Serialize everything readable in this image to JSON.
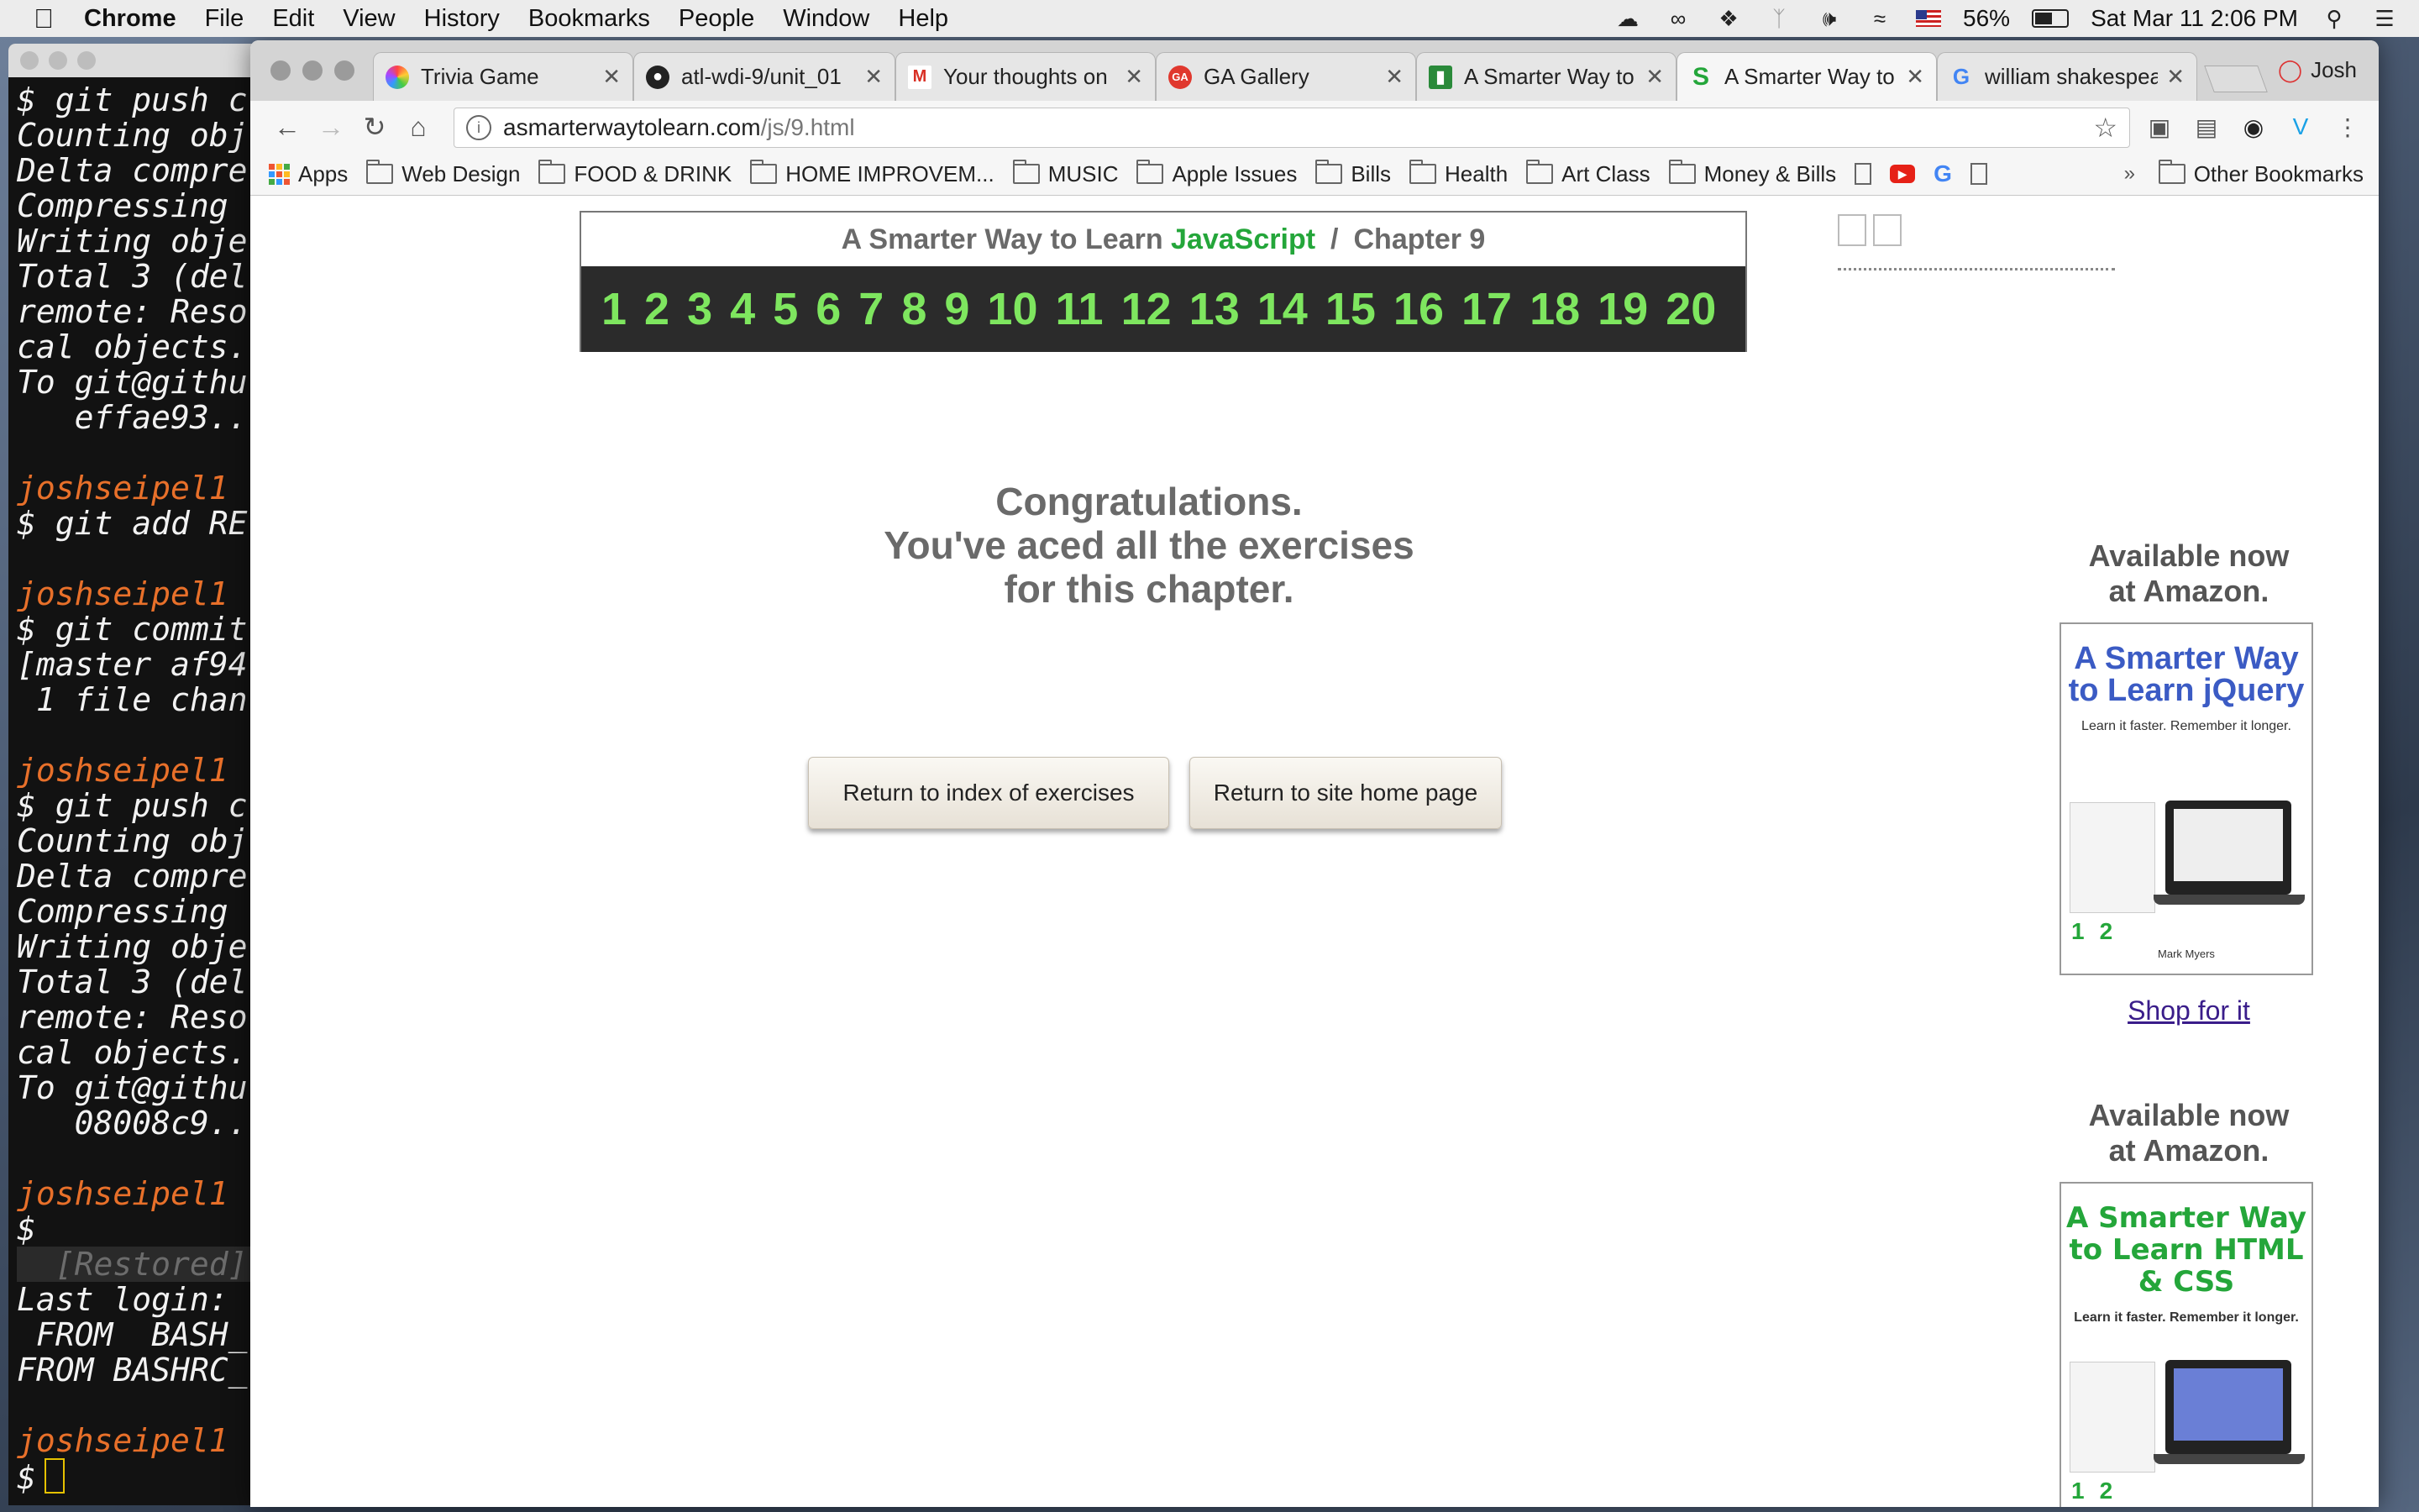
{
  "menubar": {
    "app": "Chrome",
    "items": [
      "File",
      "Edit",
      "View",
      "History",
      "Bookmarks",
      "People",
      "Window",
      "Help"
    ],
    "battery": "56%",
    "clock": "Sat Mar 11  2:06 PM"
  },
  "terminal": {
    "lines": [
      {
        "t": "$ git push c",
        "c": "w"
      },
      {
        "t": "Counting obj",
        "c": "w"
      },
      {
        "t": "Delta compre",
        "c": "w"
      },
      {
        "t": "Compressing ",
        "c": "w"
      },
      {
        "t": "Writing obje",
        "c": "w"
      },
      {
        "t": "Total 3 (del",
        "c": "w"
      },
      {
        "t": "remote: Reso",
        "c": "w"
      },
      {
        "t": "cal objects.",
        "c": "w"
      },
      {
        "t": "To git@githu",
        "c": "w"
      },
      {
        "t": "   effae93..",
        "c": "w"
      },
      {
        "t": "",
        "c": "w"
      },
      {
        "t": "joshseipel1",
        "c": "o"
      },
      {
        "t": "$ git add RE",
        "c": "w"
      },
      {
        "t": "",
        "c": "w"
      },
      {
        "t": "joshseipel1",
        "c": "o"
      },
      {
        "t": "$ git commit",
        "c": "w"
      },
      {
        "t": "[master af94",
        "c": "w"
      },
      {
        "t": " 1 file chan",
        "c": "w"
      },
      {
        "t": "",
        "c": "w"
      },
      {
        "t": "joshseipel1",
        "c": "o"
      },
      {
        "t": "$ git push c",
        "c": "w"
      },
      {
        "t": "Counting obj",
        "c": "w"
      },
      {
        "t": "Delta compre",
        "c": "w"
      },
      {
        "t": "Compressing ",
        "c": "w"
      },
      {
        "t": "Writing obje",
        "c": "w"
      },
      {
        "t": "Total 3 (del",
        "c": "w"
      },
      {
        "t": "remote: Reso",
        "c": "w"
      },
      {
        "t": "cal objects.",
        "c": "w"
      },
      {
        "t": "To git@githu",
        "c": "w"
      },
      {
        "t": "   08008c9..",
        "c": "w"
      },
      {
        "t": "",
        "c": "w"
      },
      {
        "t": "joshseipel1",
        "c": "o"
      },
      {
        "t": "$",
        "c": "w"
      },
      {
        "t": "  [Restored]",
        "c": "g"
      },
      {
        "t": "Last login: ",
        "c": "w"
      },
      {
        "t": " FROM  BASH_",
        "c": "w"
      },
      {
        "t": "FROM BASHRC_",
        "c": "w"
      },
      {
        "t": "",
        "c": "w"
      },
      {
        "t": "joshseipel1",
        "c": "o"
      }
    ],
    "prompt": "$"
  },
  "tabs": [
    {
      "title": "Trivia Game",
      "icon": "colorwheel-icon"
    },
    {
      "title": "atl-wdi-9/unit_01",
      "icon": "github-icon"
    },
    {
      "title": "Your thoughts on",
      "icon": "gmail-icon"
    },
    {
      "title": "GA Gallery",
      "icon": "ga-icon"
    },
    {
      "title": "A Smarter Way to",
      "icon": "smarter-icon"
    },
    {
      "title": "A Smarter Way to",
      "icon": "s-icon"
    },
    {
      "title": "william shakespea",
      "icon": "google-icon"
    }
  ],
  "profile": "Josh",
  "url": {
    "host": "asmarterwaytolearn.com",
    "path": "/js/9.html"
  },
  "bookmarks": [
    "Apps",
    "Web Design",
    "FOOD & DRINK",
    "HOME IMPROVEM...",
    "MUSIC",
    "Apple Issues",
    "Bills",
    "Health",
    "Art Class",
    "Money & Bills"
  ],
  "other_bookmarks": "Other Bookmarks",
  "page": {
    "header_prefix": "A Smarter Way to Learn",
    "header_subject": "JavaScript",
    "header_sep": "/",
    "header_chapter": "Chapter 9",
    "chapter_numbers": [
      "1",
      "2",
      "3",
      "4",
      "5",
      "6",
      "7",
      "8",
      "9",
      "10",
      "11",
      "12",
      "13",
      "14",
      "15",
      "16",
      "17",
      "18",
      "19",
      "20"
    ],
    "congrats_lines": [
      "Congratulations.",
      "You've aced all the exercises",
      "for this chapter."
    ],
    "btn_index": "Return to index of exercises",
    "btn_home": "Return to site home page"
  },
  "ads": [
    {
      "title_lines": [
        "Available now",
        "at Amazon."
      ],
      "book_title": "A Smarter Way to Learn jQuery",
      "book_color": "#3b5bc4",
      "tagline": "Learn it faster. Remember it longer.",
      "author": "Mark Myers",
      "link": "Shop for it"
    },
    {
      "title_lines": [
        "Available now",
        "at Amazon."
      ],
      "book_title": "A Smarter Way to Learn HTML & CSS",
      "book_color": "#24a63a",
      "tagline": "Learn it faster. Remember it longer."
    }
  ],
  "colors": {
    "accent_green": "#7ee65f",
    "js_green": "#24a63a",
    "prompt_orange": "#e8702a"
  }
}
